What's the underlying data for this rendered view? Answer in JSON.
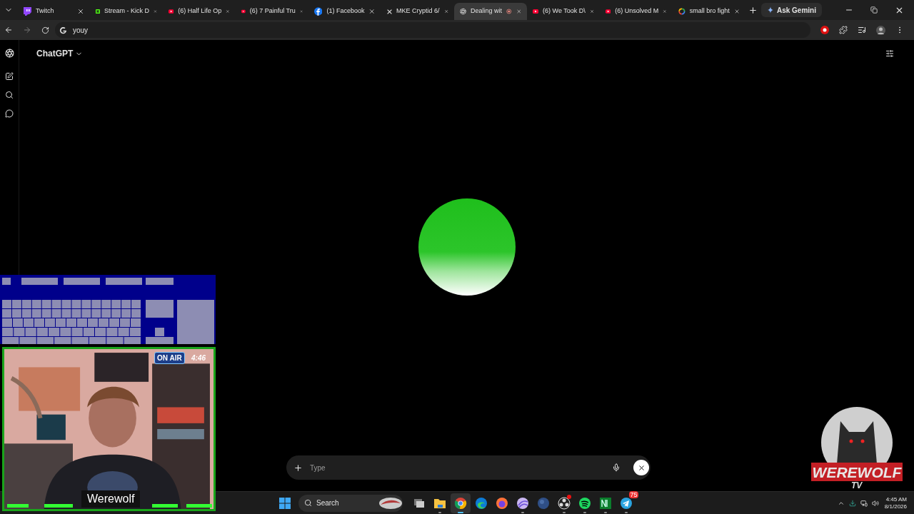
{
  "browser": {
    "tabs": [
      {
        "title": "Twitch",
        "kind": "twitch",
        "selected": false,
        "recording": false
      },
      {
        "title": "Stream - Kick D",
        "kind": "kick",
        "selected": false,
        "recording": false
      },
      {
        "title": "(6) Half Life Op",
        "kind": "youtube",
        "selected": false,
        "recording": false
      },
      {
        "title": "(6) 7 Painful Tru",
        "kind": "youtube",
        "selected": false,
        "recording": false
      },
      {
        "title": "(1) Facebook",
        "kind": "facebook",
        "selected": false,
        "recording": false
      },
      {
        "title": "MKE Cryptid 6/",
        "kind": "x",
        "selected": false,
        "recording": false
      },
      {
        "title": "Dealing wit",
        "kind": "chatgpt",
        "selected": true,
        "recording": true
      },
      {
        "title": "(6) We Took D\\",
        "kind": "youtube",
        "selected": false,
        "recording": false
      },
      {
        "title": "(6) Unsolved M",
        "kind": "youtube",
        "selected": false,
        "recording": false
      },
      {
        "title": "small bro fight",
        "kind": "google",
        "selected": false,
        "recording": false
      }
    ],
    "ask_button": "Ask Gemini",
    "address": "youy"
  },
  "app": {
    "title": "ChatGPT",
    "composer": {
      "placeholder": "Type"
    }
  },
  "overlay": {
    "badge": "ON AIR",
    "timer": "4:46",
    "name": "Werewolf",
    "logo_title": "WEREWOLF",
    "logo_subtitle": "TV"
  },
  "taskbar": {
    "search": "Search",
    "apps": [
      {
        "kind": "taskview",
        "active": false,
        "running": false
      },
      {
        "kind": "folder",
        "active": false,
        "running": true
      },
      {
        "kind": "chrome",
        "active": true,
        "running": true
      },
      {
        "kind": "edge",
        "active": false,
        "running": false
      },
      {
        "kind": "firefox",
        "active": false,
        "running": false
      },
      {
        "kind": "swirl",
        "active": false,
        "running": true
      },
      {
        "kind": "orb",
        "active": false,
        "running": false
      },
      {
        "kind": "obs",
        "active": false,
        "running": true,
        "alert": true
      },
      {
        "kind": "spotify",
        "active": false,
        "running": true
      },
      {
        "kind": "notebook",
        "active": false,
        "running": true
      },
      {
        "kind": "telegram",
        "active": false,
        "running": true,
        "badge": "75"
      }
    ],
    "time": "4:45 AM",
    "date": "8/1/2026"
  }
}
